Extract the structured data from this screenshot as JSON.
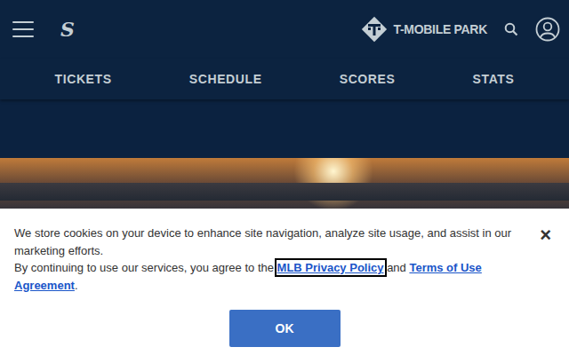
{
  "header": {
    "menu_label": "",
    "team_logo": "S",
    "park_name": "T-MOBILE PARK"
  },
  "nav": [
    {
      "label": "TICKETS"
    },
    {
      "label": "SCHEDULE"
    },
    {
      "label": "SCORES"
    },
    {
      "label": "STATS"
    }
  ],
  "cookie_banner": {
    "line1": "We store cookies on your device to enhance site navigation, analyze site usage, and assist in our marketing efforts.",
    "line2_before": "By continuing to use our services, you agree to the ",
    "privacy_link": {
      "label": "MLB Privacy Policy",
      "focused": true
    },
    "between": " and ",
    "terms_link": {
      "label": "Terms of Use Agreement",
      "focused": false
    },
    "after": ".",
    "close": "×",
    "button": "OK"
  }
}
